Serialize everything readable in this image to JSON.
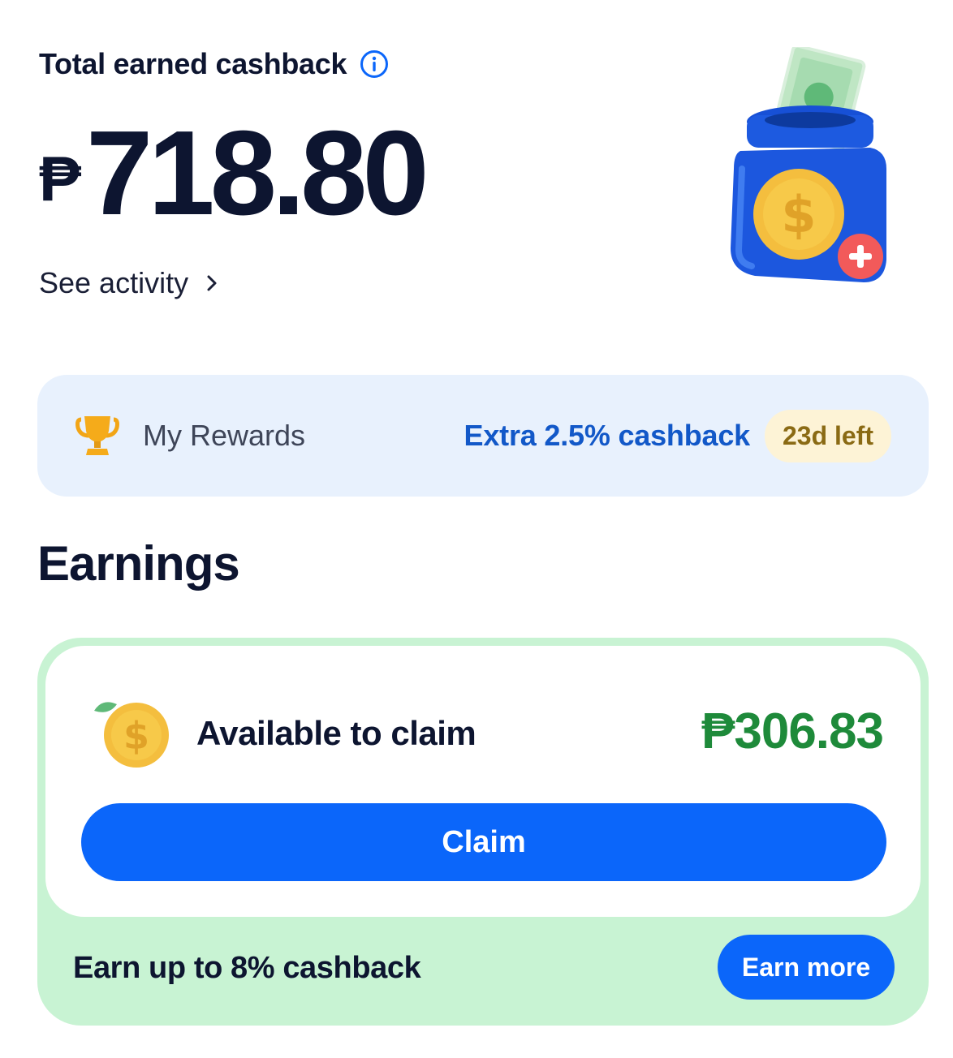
{
  "summary": {
    "total_label": "Total earned cashback",
    "currency_symbol": "₱",
    "total_amount": "718.80",
    "see_activity_label": "See activity"
  },
  "rewards": {
    "label": "My Rewards",
    "extra_label": "Extra 2.5% cashback",
    "days_left": "23d left"
  },
  "earnings": {
    "title": "Earnings",
    "available_label": "Available to claim",
    "available_amount": "₱306.83",
    "claim_label": "Claim",
    "earn_upto_label": "Earn up to 8% cashback",
    "earn_more_label": "Earn more"
  },
  "icons": {
    "info": "info-icon",
    "chevron": "chevron-right-icon",
    "jar": "cashback-jar-illustration",
    "trophy": "trophy-icon",
    "coin": "coin-icon"
  },
  "colors": {
    "primary_blue": "#0b66fa",
    "rewards_bg": "#e8f1fd",
    "rewards_text": "#1258c8",
    "badge_bg": "#fdf3d6",
    "badge_text": "#8a6a14",
    "earnings_card_bg": "#c8f3d3",
    "amount_green": "#1e8a3a",
    "text_dark": "#0d1530"
  }
}
